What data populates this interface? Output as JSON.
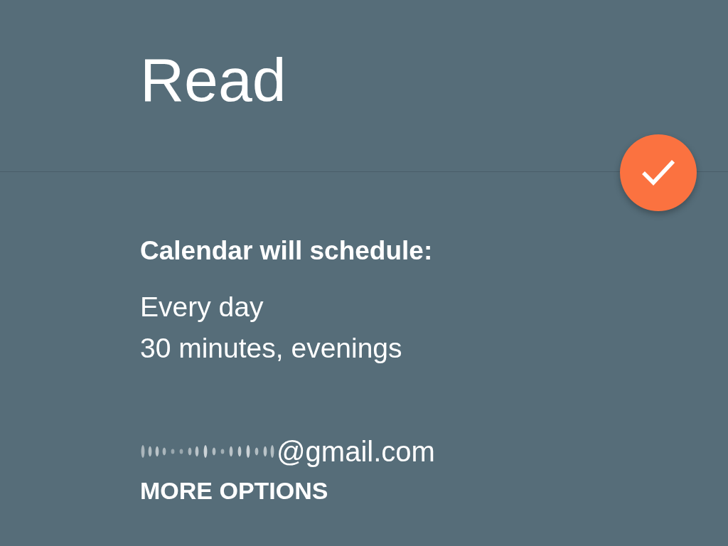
{
  "header": {
    "title": "Read"
  },
  "schedule": {
    "heading": "Calendar will schedule:",
    "lines": [
      "Every day",
      "30 minutes, evenings"
    ]
  },
  "account": {
    "email": "@gmail.com"
  },
  "more_options": {
    "label": "MORE OPTIONS"
  }
}
